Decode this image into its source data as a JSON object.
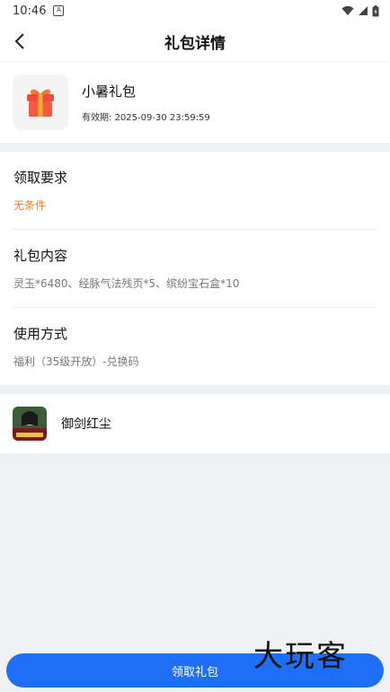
{
  "status_bar": {
    "time": "10:46",
    "notification_icon": "A"
  },
  "header": {
    "title": "礼包详情"
  },
  "gift": {
    "name": "小暑礼包",
    "valid_label": "有效期:",
    "valid_until": "2025-09-30 23:59:59"
  },
  "details": [
    {
      "title": "领取要求",
      "value": "无条件",
      "accent": "#f47c2a"
    },
    {
      "title": "礼包内容",
      "value": "灵玉*6480、经脉气法残页*5、缤纷宝石盒*10"
    },
    {
      "title": "使用方式",
      "value": "福利（35级开放）-兑换码"
    }
  ],
  "game": {
    "name": "御剑红尘"
  },
  "footer": {
    "claim_label": "领取礼包"
  },
  "watermark": "大玩客",
  "colors": {
    "accent": "#1e6ff5",
    "orange": "#f47c2a",
    "gift_red": "#ef4b3c"
  }
}
